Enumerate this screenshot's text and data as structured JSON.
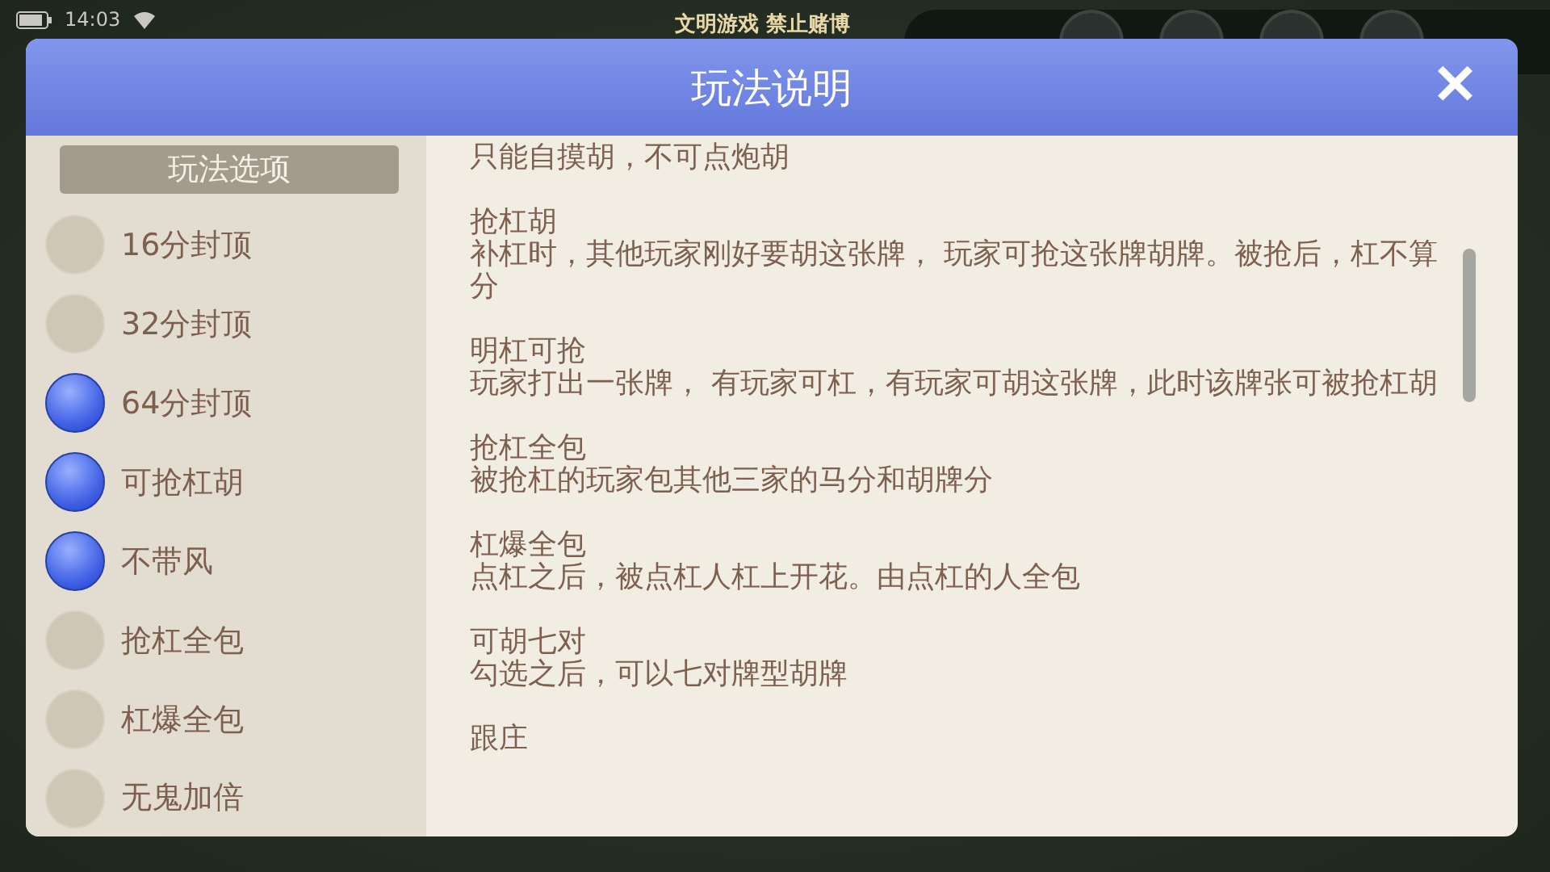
{
  "status_bar": {
    "time": "14:03"
  },
  "banner": "文明游戏 禁止赌博",
  "dialog": {
    "title": "玩法说明",
    "close": "✕"
  },
  "sidebar": {
    "title": "玩法选项",
    "options": [
      {
        "label": "16分封顶",
        "checked": false
      },
      {
        "label": "32分封顶",
        "checked": false
      },
      {
        "label": "64分封顶",
        "checked": true
      },
      {
        "label": "可抢杠胡",
        "checked": true
      },
      {
        "label": "不带风",
        "checked": true
      },
      {
        "label": "抢杠全包",
        "checked": false
      },
      {
        "label": "杠爆全包",
        "checked": false
      },
      {
        "label": "无鬼加倍",
        "checked": false
      }
    ]
  },
  "rules": [
    {
      "body": "只能自摸胡，不可点炮胡"
    },
    {
      "title": "抢杠胡",
      "body": "补杠时，其他玩家刚好要胡这张牌， 玩家可抢这张牌胡牌。被抢后，杠不算分"
    },
    {
      "title": "明杠可抢",
      "body": "玩家打出一张牌， 有玩家可杠，有玩家可胡这张牌，此时该牌张可被抢杠胡"
    },
    {
      "title": "抢杠全包",
      "body": "被抢杠的玩家包其他三家的马分和胡牌分"
    },
    {
      "title": "杠爆全包",
      "body": "点杠之后，被点杠人杠上开花。由点杠的人全包"
    },
    {
      "title": "可胡七对",
      "body": "勾选之后，可以七对牌型胡牌"
    },
    {
      "title": "跟庄"
    }
  ]
}
